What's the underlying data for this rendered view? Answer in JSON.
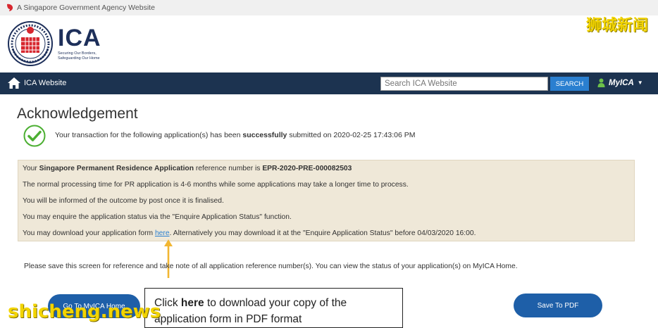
{
  "gov_bar": {
    "text": "A Singapore Government Agency Website"
  },
  "logo": {
    "name": "ICA",
    "tagline_1": "Securing Our Borders,",
    "tagline_2": "Safeguarding Our Home"
  },
  "watermark_cn": "狮城新闻",
  "nav": {
    "home_label": "ICA Website",
    "search_placeholder": "Search ICA Website",
    "search_button": "SEARCH",
    "account_label": "MyICA"
  },
  "page": {
    "title": "Acknowledgement",
    "success": {
      "prefix": "Your transaction for the following application(s) has been ",
      "strong": "successfully",
      "suffix": " submitted on 2020-02-25 17:43:06 PM"
    },
    "info": {
      "line1_prefix": "Your ",
      "line1_app": "Singapore Permanent Residence Application",
      "line1_mid": " reference number is ",
      "line1_ref": "EPR-2020-PRE-000082503",
      "line2": "The normal processing time for PR application is 4-6 months while some applications may take a longer time to process.",
      "line3": "You will be informed of the outcome by post once it is finalised.",
      "line4": "You may enquire the application status via the \"Enquire Application Status\" function.",
      "line5_prefix": "You may download your application form ",
      "line5_link": "here",
      "line5_suffix": ". Alternatively you may download it at the \"Enquire Application Status\" before 04/03/2020 16:00."
    },
    "save_note": "Please save this screen for reference and take note of all application reference number(s). You can view the status of your application(s) on MyICA Home.",
    "buttons": {
      "home": "Go To MyICA Home",
      "pdf": "Save To PDF"
    }
  },
  "callout": {
    "prefix": "Click ",
    "strong": "here",
    "suffix": " to download your copy of the application form in PDF format"
  },
  "watermark_site": "shicheng.news",
  "colors": {
    "nav_bg": "#1c3350",
    "accent": "#2a7fd0",
    "panel_bg": "#efe8d8",
    "button_bg": "#1e5fa8",
    "watermark": "#f2d400",
    "success_green": "#4caf32"
  }
}
